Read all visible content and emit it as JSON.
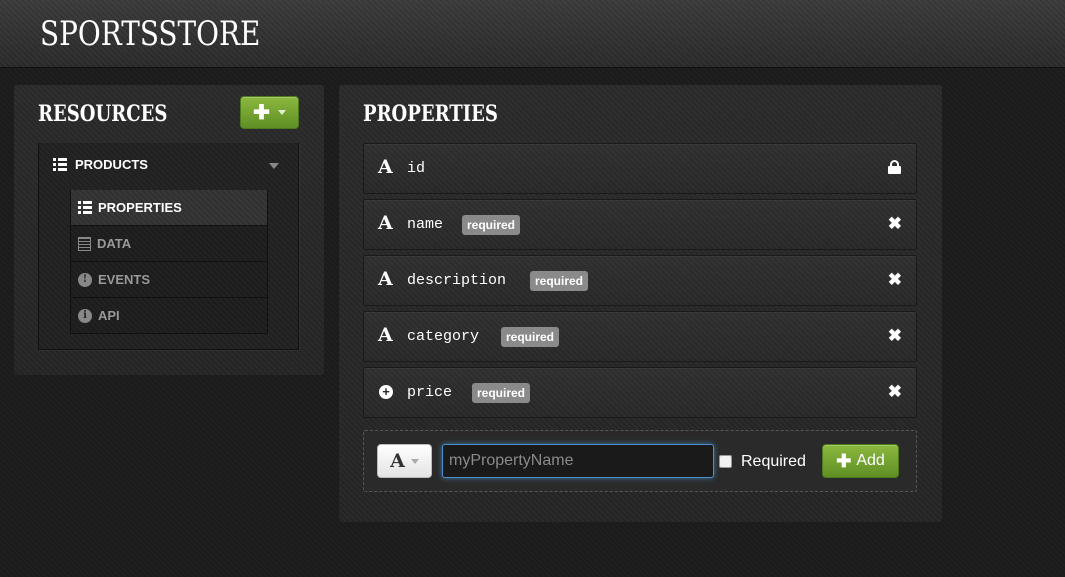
{
  "header": {
    "brand": "SPORTSSTORE"
  },
  "resources": {
    "title": "RESOURCES",
    "add_icon": "plus-icon",
    "resource": {
      "label": "PRODUCTS"
    },
    "items": [
      {
        "label": "PROPERTIES",
        "icon": "list-icon",
        "active": true
      },
      {
        "label": "DATA",
        "icon": "table-icon",
        "active": false
      },
      {
        "label": "EVENTS",
        "icon": "exclamation-icon",
        "active": false
      },
      {
        "label": "API",
        "icon": "info-icon",
        "active": false
      }
    ]
  },
  "properties": {
    "title": "PROPERTIES",
    "required_badge": "required",
    "rows": [
      {
        "name": "id",
        "type_icon": "A",
        "required": false,
        "action": "lock-icon"
      },
      {
        "name": "name",
        "type_icon": "A",
        "required": true,
        "badge": "required",
        "action": "remove-icon",
        "action_glyph": "✖"
      },
      {
        "name": "description",
        "type_icon": "A",
        "required": true,
        "badge": "required",
        "action": "remove-icon",
        "action_glyph": "✖"
      },
      {
        "name": "category",
        "type_icon": "A",
        "required": true,
        "badge": "required",
        "action": "remove-icon",
        "action_glyph": "✖"
      },
      {
        "name": "price",
        "type_icon": "+",
        "required": true,
        "badge": "required",
        "action": "remove-icon",
        "action_glyph": "✖"
      }
    ],
    "new_property": {
      "type_label": "A",
      "name_value": "",
      "name_placeholder": "myPropertyName",
      "required_label": "Required",
      "required_checked": false,
      "add_label": "Add",
      "add_glyph": "✚"
    }
  },
  "colors": {
    "accent_green": "#6fa32f",
    "focus_blue": "#52a8ec",
    "badge_gray": "#8a8a8a"
  }
}
